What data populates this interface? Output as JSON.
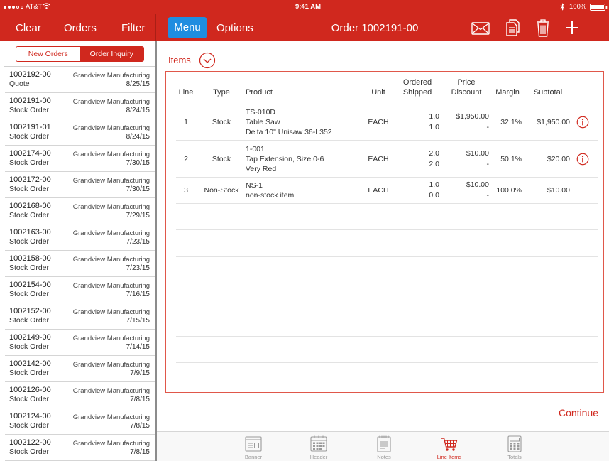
{
  "colors": {
    "brand_red": "#d0281e",
    "menu_blue": "#1f8de0",
    "border_red": "#e0574a"
  },
  "status_bar": {
    "signal_bars": 3,
    "carrier": "AT&T",
    "time": "9:41 AM",
    "battery": "100%"
  },
  "left_nav": {
    "clear_label": "Clear",
    "orders_label": "Orders",
    "filter_label": "Filter"
  },
  "segments": {
    "new_orders": "New Orders",
    "order_inquiry": "Order Inquiry",
    "selected": "order_inquiry"
  },
  "orders": [
    {
      "number": "1002192-00",
      "type": "Quote",
      "customer": "Grandview Manufacturing",
      "date": "8/25/15"
    },
    {
      "number": "1002191-00",
      "type": "Stock Order",
      "customer": "Grandview Manufacturing",
      "date": "8/24/15"
    },
    {
      "number": "1002191-01",
      "type": "Stock Order",
      "customer": "Grandview Manufacturing",
      "date": "8/24/15"
    },
    {
      "number": "1002174-00",
      "type": "Stock Order",
      "customer": "Grandview Manufacturing",
      "date": "7/30/15"
    },
    {
      "number": "1002172-00",
      "type": "Stock Order",
      "customer": "Grandview Manufacturing",
      "date": "7/30/15"
    },
    {
      "number": "1002168-00",
      "type": "Stock Order",
      "customer": "Grandview Manufacturing",
      "date": "7/29/15"
    },
    {
      "number": "1002163-00",
      "type": "Stock Order",
      "customer": "Grandview Manufacturing",
      "date": "7/23/15"
    },
    {
      "number": "1002158-00",
      "type": "Stock Order",
      "customer": "Grandview Manufacturing",
      "date": "7/23/15"
    },
    {
      "number": "1002154-00",
      "type": "Stock Order",
      "customer": "Grandview Manufacturing",
      "date": "7/16/15"
    },
    {
      "number": "1002152-00",
      "type": "Stock Order",
      "customer": "Grandview Manufacturing",
      "date": "7/15/15"
    },
    {
      "number": "1002149-00",
      "type": "Stock Order",
      "customer": "Grandview Manufacturing",
      "date": "7/14/15"
    },
    {
      "number": "1002142-00",
      "type": "Stock Order",
      "customer": "Grandview Manufacturing",
      "date": "7/9/15"
    },
    {
      "number": "1002126-00",
      "type": "Stock Order",
      "customer": "Grandview Manufacturing",
      "date": "7/8/15"
    },
    {
      "number": "1002124-00",
      "type": "Stock Order",
      "customer": "Grandview Manufacturing",
      "date": "7/8/15"
    },
    {
      "number": "1002122-00",
      "type": "Stock Order",
      "customer": "Grandview Manufacturing",
      "date": "7/8/15"
    }
  ],
  "main_nav": {
    "menu_label": "Menu",
    "options_label": "Options",
    "title": "Order 1002191-00"
  },
  "toolbar_icons": [
    "envelope-icon",
    "copy-icon",
    "trash-icon",
    "plus-icon"
  ],
  "items": {
    "label": "Items"
  },
  "table": {
    "headers": {
      "line": "Line",
      "type": "Type",
      "product": "Product",
      "unit": "Unit",
      "ordered": "Ordered",
      "shipped": "Shipped",
      "price": "Price",
      "discount": "Discount",
      "margin": "Margin",
      "subtotal": "Subtotal"
    },
    "rows": [
      {
        "line": "1",
        "type": "Stock",
        "product": [
          "TS-010D",
          "Table Saw",
          "Delta 10\" Unisaw 36-L352"
        ],
        "unit": "EACH",
        "ordered": "1.0",
        "shipped": "1.0",
        "price": "$1,950.00",
        "discount": "-",
        "margin": "32.1%",
        "subtotal": "$1,950.00",
        "has_info": true
      },
      {
        "line": "2",
        "type": "Stock",
        "product": [
          "1-001",
          "Tap Extension, Size 0-6",
          "Very Red"
        ],
        "unit": "EACH",
        "ordered": "2.0",
        "shipped": "2.0",
        "price": "$10.00",
        "discount": "-",
        "margin": "50.1%",
        "subtotal": "$20.00",
        "has_info": true
      },
      {
        "line": "3",
        "type": "Non-Stock",
        "product": [
          "NS-1",
          "non-stock item"
        ],
        "unit": "EACH",
        "ordered": "1.0",
        "shipped": "0.0",
        "price": "$10.00",
        "discount": "-",
        "margin": "100.0%",
        "subtotal": "$10.00",
        "has_info": false
      }
    ]
  },
  "continue_label": "Continue",
  "tabs": [
    {
      "label": "Banner",
      "icon": "banner-icon",
      "active": false
    },
    {
      "label": "Header",
      "icon": "header-icon",
      "active": false
    },
    {
      "label": "Notes",
      "icon": "notes-icon",
      "active": false
    },
    {
      "label": "Line Items",
      "icon": "cart-icon",
      "active": true
    },
    {
      "label": "Totals",
      "icon": "calculator-icon",
      "active": false
    }
  ]
}
